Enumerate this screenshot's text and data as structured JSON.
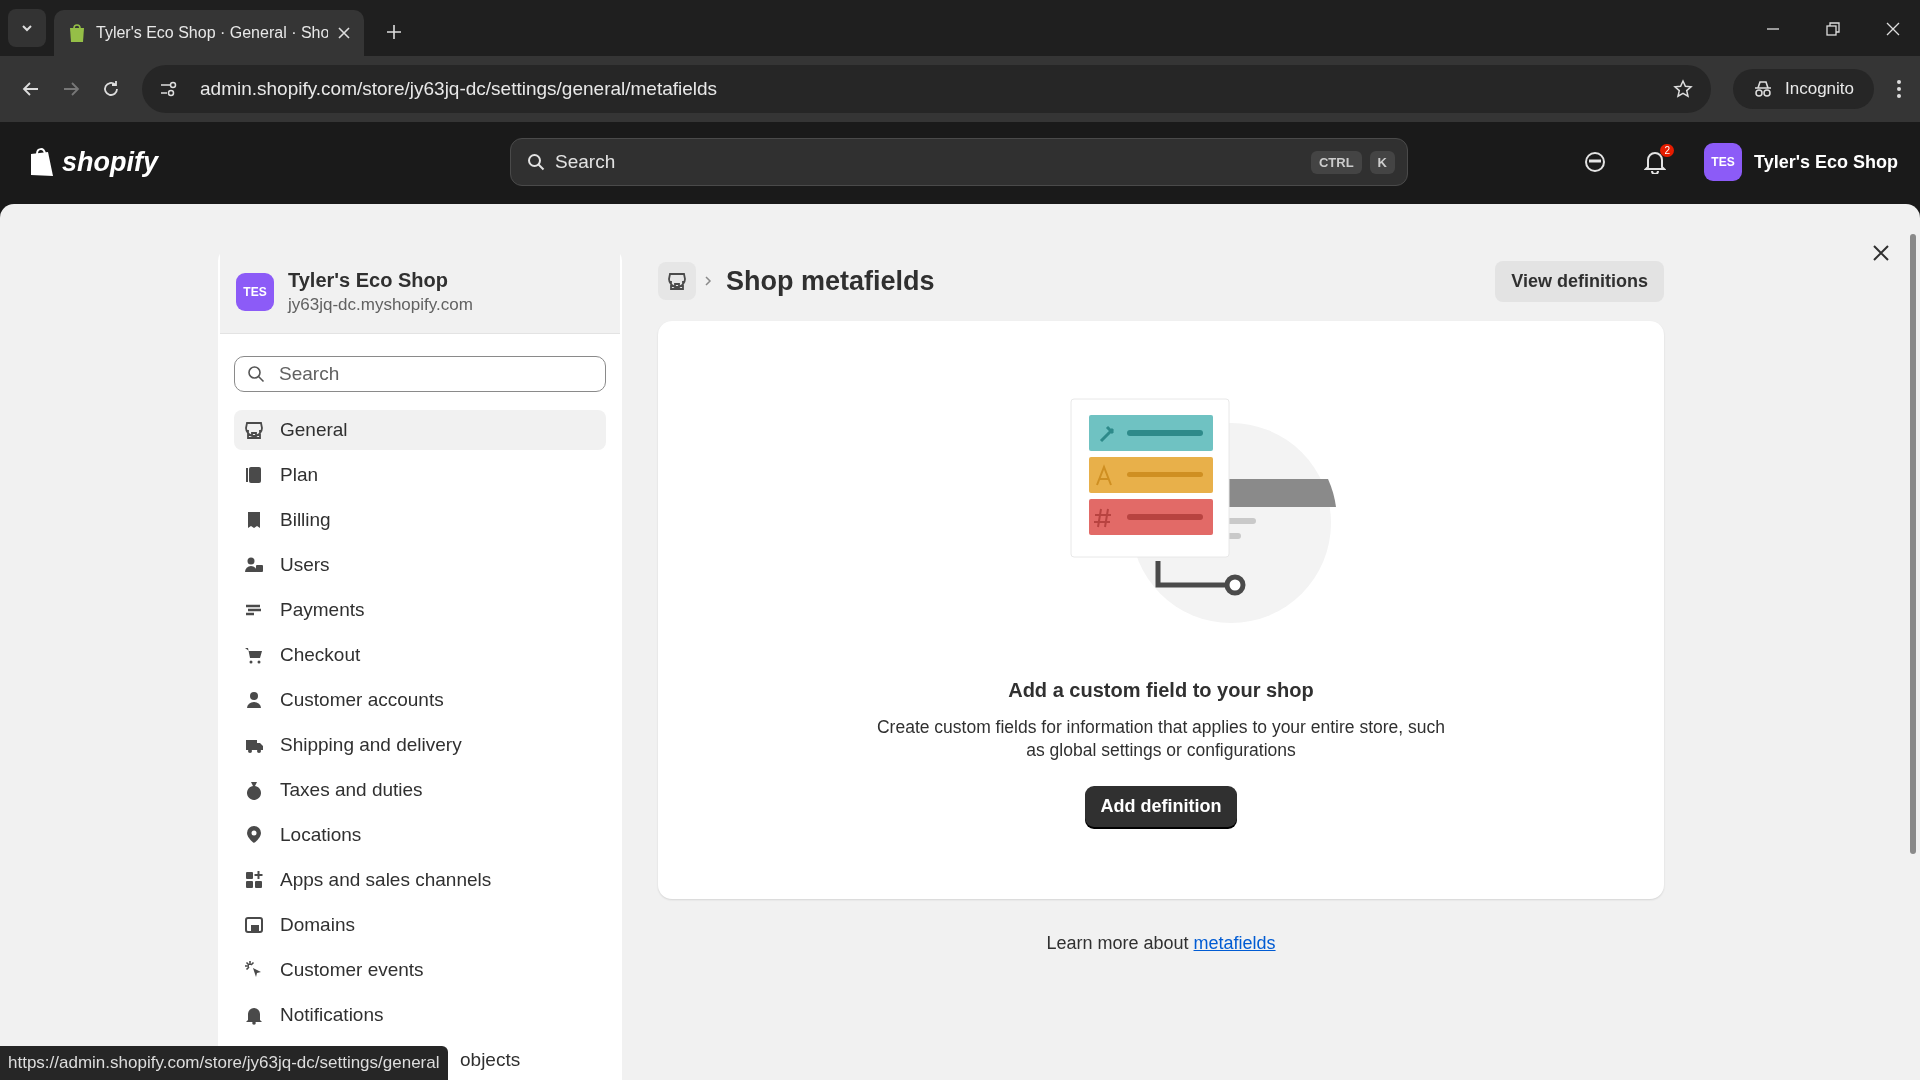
{
  "browser": {
    "tab_title": "Tyler's Eco Shop · General · Sho",
    "url": "admin.shopify.com/store/jy63jq-dc/settings/general/metafields",
    "incognito_label": "Incognito"
  },
  "topbar": {
    "logo": "shopify",
    "search_placeholder": "Search",
    "shortcut_keys": [
      "CTRL",
      "K"
    ],
    "notification_count": "2",
    "avatar_initials": "TES",
    "store_name": "Tyler's Eco Shop"
  },
  "sidebar": {
    "avatar_initials": "TES",
    "store_name": "Tyler's Eco Shop",
    "store_domain": "jy63jq-dc.myshopify.com",
    "search_placeholder": "Search",
    "items": [
      {
        "label": "General",
        "selected": true
      },
      {
        "label": "Plan",
        "selected": false
      },
      {
        "label": "Billing",
        "selected": false
      },
      {
        "label": "Users",
        "selected": false
      },
      {
        "label": "Payments",
        "selected": false
      },
      {
        "label": "Checkout",
        "selected": false
      },
      {
        "label": "Customer accounts",
        "selected": false
      },
      {
        "label": "Shipping and delivery",
        "selected": false
      },
      {
        "label": "Taxes and duties",
        "selected": false
      },
      {
        "label": "Locations",
        "selected": false
      },
      {
        "label": "Apps and sales channels",
        "selected": false
      },
      {
        "label": "Domains",
        "selected": false
      },
      {
        "label": "Customer events",
        "selected": false
      },
      {
        "label": "Notifications",
        "selected": false
      },
      {
        "label": "objects",
        "selected": false
      }
    ]
  },
  "main": {
    "title": "Shop metafields",
    "view_button": "View definitions",
    "empty_heading": "Add a custom field to your shop",
    "empty_text": "Create custom fields for information that applies to your entire store, such as global settings or configurations",
    "add_button": "Add definition",
    "learn_prefix": "Learn more about",
    "learn_link": "metafields"
  },
  "status_url": "https://admin.shopify.com/store/jy63jq-dc/settings/general"
}
